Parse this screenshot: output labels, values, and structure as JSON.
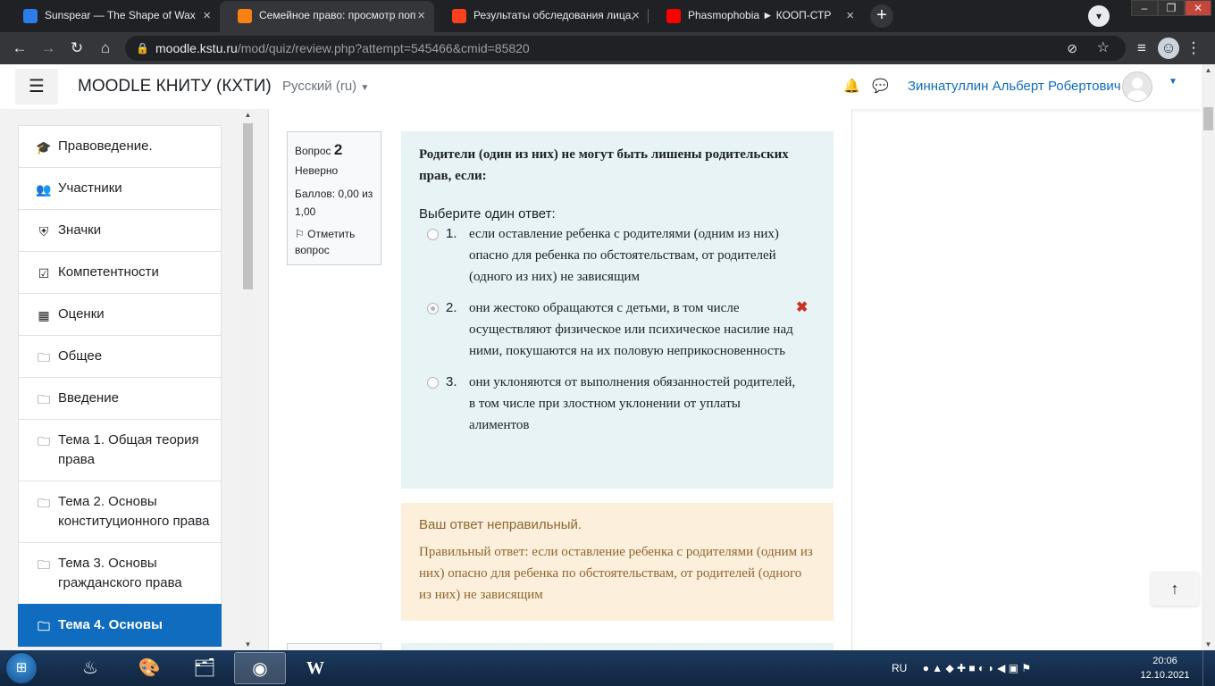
{
  "browser": {
    "tabs": [
      {
        "title": "Sunspear — The Shape of Wax",
        "icon": "chat-icon",
        "color": "#2b7de9"
      },
      {
        "title": "Семейное право: просмотр поп",
        "icon": "moodle-icon",
        "color": "#f98012"
      },
      {
        "title": "Результаты обследования лица,",
        "icon": "yandex-icon",
        "color": "#fc3f1d"
      },
      {
        "title": "Phasmophobia ► КООП-СТР",
        "icon": "youtube-icon",
        "color": "#ff0000"
      }
    ],
    "active_tab_index": 1,
    "new_tab": "+",
    "url_host": "moodle.kstu.ru",
    "url_path": "/mod/quiz/review.php?attempt=545466&cmid=85820"
  },
  "header": {
    "menu_icon": "☰",
    "brand": "MOODLE КНИТУ (КХТИ)",
    "language": "Русский (ru)",
    "user_name": "Зиннатуллин Альберт Робертович"
  },
  "sidebar": {
    "items": [
      {
        "label": "Правоведение.",
        "icon": "graduation-cap-icon",
        "glyph": "🎓"
      },
      {
        "label": "Участники",
        "icon": "users-icon",
        "glyph": "👥"
      },
      {
        "label": "Значки",
        "icon": "shield-icon",
        "glyph": "⛨"
      },
      {
        "label": "Компетентности",
        "icon": "checkbox-icon",
        "glyph": "☑"
      },
      {
        "label": "Оценки",
        "icon": "table-icon",
        "glyph": "▦"
      },
      {
        "label": "Общее",
        "icon": "folder-icon",
        "glyph": "🗀"
      },
      {
        "label": "Введение",
        "icon": "folder-icon",
        "glyph": "🗀"
      },
      {
        "label": "Тема 1. Общая теория права",
        "icon": "folder-icon",
        "glyph": "🗀"
      },
      {
        "label": "Тема 2. Основы конституционного права",
        "icon": "folder-icon",
        "glyph": "🗀"
      },
      {
        "label": "Тема 3. Основы гражданского права",
        "icon": "folder-icon",
        "glyph": "🗀"
      },
      {
        "label": "Тема 4. Основы",
        "icon": "folder-icon",
        "glyph": "🗀"
      }
    ],
    "active_index": 10
  },
  "question": {
    "label": "Вопрос",
    "number": "2",
    "state": "Неверно",
    "grade": "Баллов: 0,00 из 1,00",
    "flag": "Отметить вопрос",
    "text": "Родители (один из них) не могут быть лишены родительских прав, если:",
    "prompt": "Выберите один ответ:",
    "answers": [
      {
        "num": "1.",
        "text": "если оставление ребенка с родителями (одним из них) опасно для ребенка по обстоятельствам, от родителей (одного из них) не зависящим",
        "selected": false,
        "incorrect_mark": false
      },
      {
        "num": "2.",
        "text": "они жестоко обращаются с детьми, в том числе осуществляют физическое или психическое насилие над ними, покушаются на их половую неприкосновенность",
        "selected": true,
        "incorrect_mark": true
      },
      {
        "num": "3.",
        "text": "они уклоняются от выполнения обязанностей родителей, в том числе при злостном уклонении от уплаты алиментов",
        "selected": false,
        "incorrect_mark": false
      }
    ]
  },
  "outcome": {
    "feedback": "Ваш ответ неправильный.",
    "right_answer": "Правильный ответ: если оставление ребенка с родителями (одним из них) опасно для ребенка по обстоятельствам, от родителей (одного из них) не зависящим"
  },
  "taskbar": {
    "language": "RU",
    "time": "20:06",
    "date": "12.10.2021",
    "apps": [
      {
        "icon": "steam-icon",
        "glyph": "♨"
      },
      {
        "icon": "paint-icon",
        "glyph": "🎨"
      },
      {
        "icon": "file-explorer-icon",
        "glyph": "🗂"
      },
      {
        "icon": "chrome-icon",
        "glyph": "◉"
      },
      {
        "icon": "word-icon",
        "glyph": "W"
      }
    ]
  },
  "colors": {
    "accent": "#0f6cbf",
    "question_bg": "#e7f3f5",
    "outcome_bg": "#fcefdc",
    "incorrect": "#ca3120"
  }
}
